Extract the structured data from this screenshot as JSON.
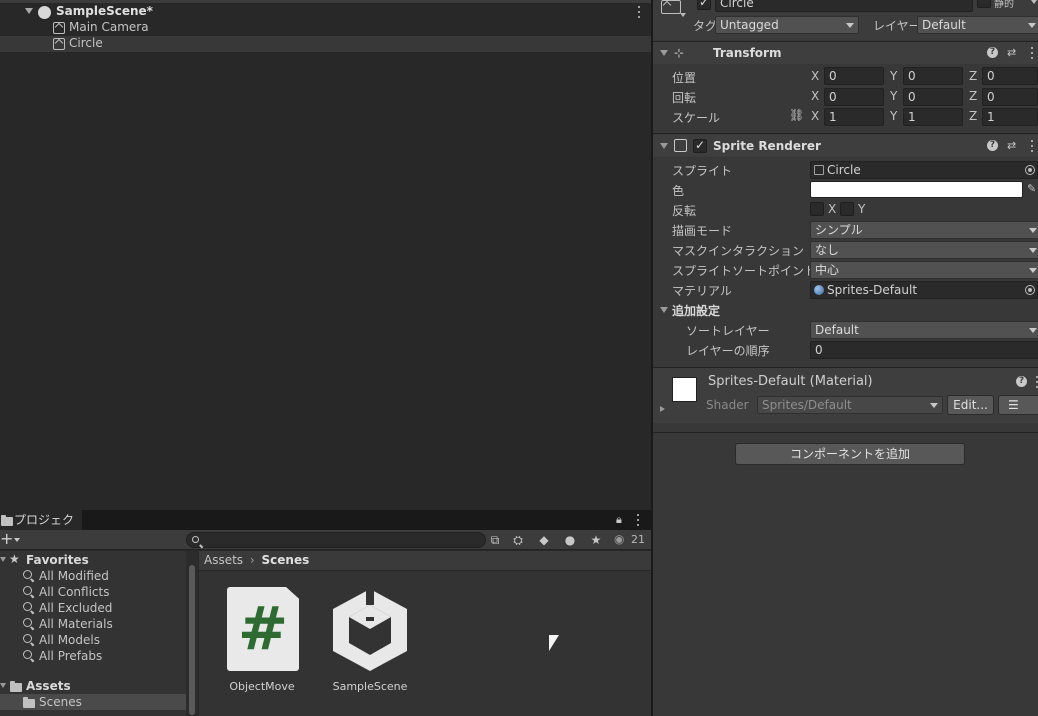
{
  "hierarchy": {
    "scene_name": "SampleScene*",
    "items": [
      "Main Camera",
      "Circle"
    ]
  },
  "inspector": {
    "object_name": "Circle",
    "static_label": "静的",
    "tag_label": "タグ",
    "tag_value": "Untagged",
    "layer_label": "レイヤー",
    "layer_value": "Default",
    "transform": {
      "title": "Transform",
      "position_label": "位置",
      "rotation_label": "回転",
      "scale_label": "スケール",
      "position": {
        "x": "0",
        "y": "0",
        "z": "0"
      },
      "rotation": {
        "x": "0",
        "y": "0",
        "z": "0"
      },
      "scale": {
        "x": "1",
        "y": "1",
        "z": "1"
      }
    },
    "sprite_renderer": {
      "title": "Sprite Renderer",
      "sprite_label": "スプライト",
      "sprite_value": "Circle",
      "color_label": "色",
      "flip_label": "反転",
      "flip_x": "X",
      "flip_y": "Y",
      "draw_mode_label": "描画モード",
      "draw_mode_value": "シンプル",
      "mask_label": "マスクインタラクション",
      "mask_value": "なし",
      "sort_point_label": "スプライトソートポイント",
      "sort_point_value": "中心",
      "material_label": "マテリアル",
      "material_value": "Sprites-Default",
      "additional_label": "追加設定",
      "sorting_layer_label": "ソートレイヤー",
      "sorting_layer_value": "Default",
      "order_label": "レイヤーの順序",
      "order_value": "0"
    },
    "material": {
      "title": "Sprites-Default (Material)",
      "shader_label": "Shader",
      "shader_value": "Sprites/Default",
      "edit_button": "Edit..."
    },
    "add_component_button": "コンポーネントを追加"
  },
  "project": {
    "tab_label": "プロジェクト",
    "visible_count": "21",
    "tree": {
      "favorites_label": "Favorites",
      "favorites": [
        "All Modified",
        "All Conflicts",
        "All Excluded",
        "All Materials",
        "All Models",
        "All Prefabs"
      ],
      "assets_label": "Assets",
      "scenes_label": "Scenes"
    },
    "breadcrumb": {
      "root": "Assets",
      "current": "Scenes"
    },
    "assets": [
      {
        "name": "ObjectMove",
        "icon": "csharp-script-icon"
      },
      {
        "name": "SampleScene",
        "icon": "unity-scene-icon"
      }
    ]
  },
  "colors": {
    "background": "#282828",
    "inspector_bg": "#383838",
    "script_green": "#2e6b32",
    "scene_icon_white": "#e8e8e8"
  }
}
